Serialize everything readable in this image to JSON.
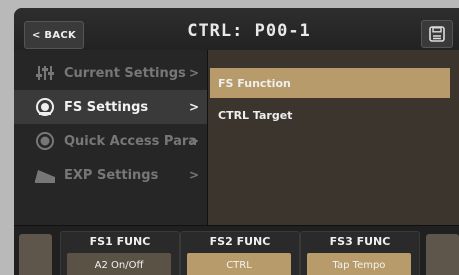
{
  "header": {
    "back_label": "< BACK",
    "title": "CTRL: P00-1",
    "save_icon": "save-icon"
  },
  "menu": {
    "items": [
      {
        "label": "Current Settings",
        "arrow": ">",
        "icon": "sliders-icon",
        "active": false
      },
      {
        "label": "FS Settings",
        "arrow": ">",
        "icon": "footswitch-icon",
        "active": true
      },
      {
        "label": "Quick Access Para",
        "arrow": ">",
        "icon": "knob-icon",
        "active": false
      },
      {
        "label": "EXP Settings",
        "arrow": ">",
        "icon": "expression-pedal-icon",
        "active": false
      }
    ]
  },
  "panel": {
    "items": [
      {
        "label": "FS Function",
        "selected": true
      },
      {
        "label": "CTRL Target",
        "selected": false
      }
    ]
  },
  "footer": {
    "cards": [
      {
        "label": "FS1 FUNC",
        "value": "A2 On/Off"
      },
      {
        "label": "FS2 FUNC",
        "value": "CTRL"
      },
      {
        "label": "FS3 FUNC",
        "value": "Tap Tempo"
      }
    ]
  },
  "colors": {
    "accent": "#b89b6a",
    "panel_bg": "#3b352d",
    "menu_bg": "#262626",
    "screen_bg": "#1e1e1e"
  }
}
